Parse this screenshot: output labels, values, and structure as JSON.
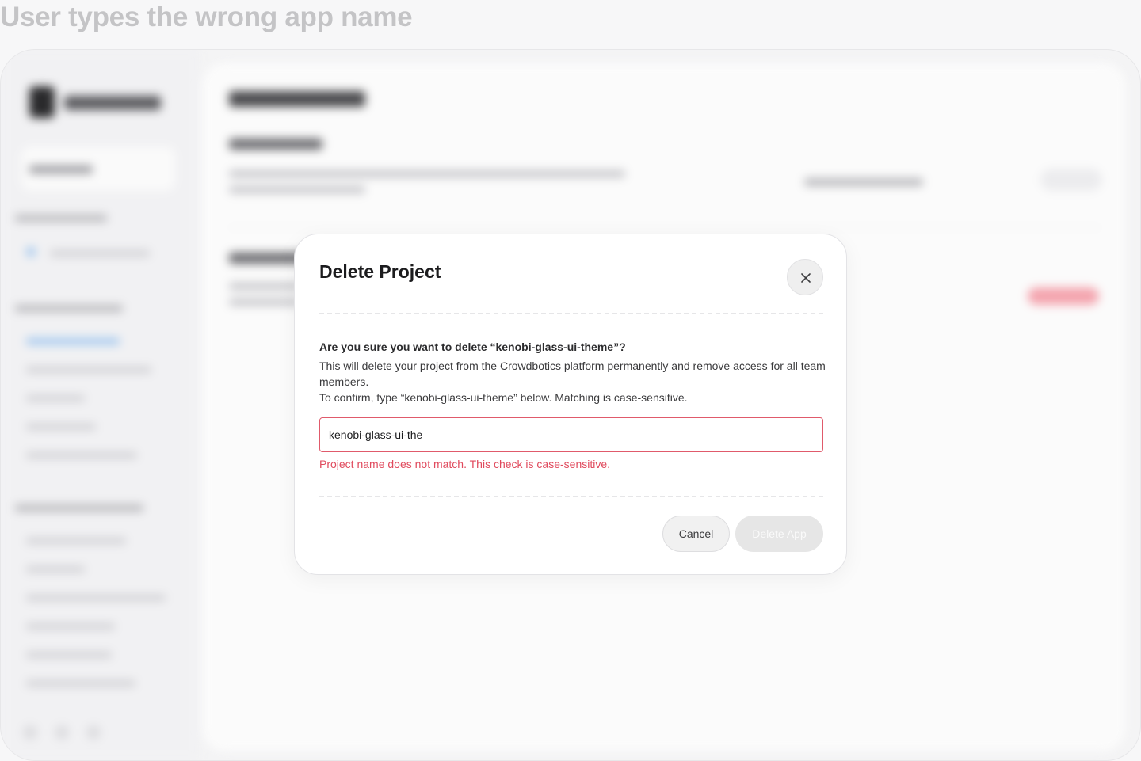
{
  "scenario_title": "User types the wrong app name",
  "modal": {
    "title": "Delete Project",
    "question": "Are you sure you want to delete “kenobi-glass-ui-theme”?",
    "description_line1": "This will delete your project from the Crowdbotics platform permanently and remove access for all team members.",
    "description_line2": "To confirm, type “kenobi-glass-ui-theme” below. Matching is case-sensitive.",
    "input_value": "kenobi-glass-ui-the",
    "error_message": "Project name does not match. This check is case-sensitive.",
    "cancel_label": "Cancel",
    "delete_label": "Delete App",
    "close_icon": "close-icon"
  },
  "colors": {
    "error": "#e04a5d",
    "disabled_button": "#e6e6e6",
    "accent": "#9cc4ee"
  }
}
